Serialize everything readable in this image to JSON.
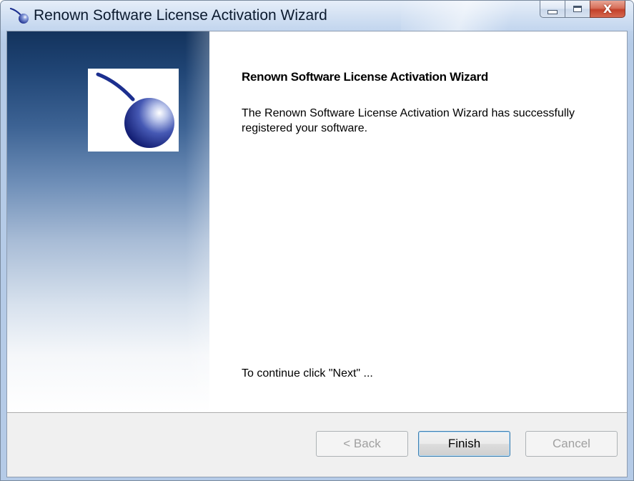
{
  "window": {
    "title": "Renown Software License Activation Wizard",
    "app_icon": "renown-logo-icon",
    "controls": {
      "minimize_icon": "minimize-icon",
      "maximize_icon": "maximize-icon",
      "close_icon": "close-icon",
      "close_glyph": "X"
    }
  },
  "banner": {
    "logo": "renown-logo"
  },
  "wizard": {
    "heading": "Renown Software License Activation Wizard",
    "message": "The Renown Software License Activation Wizard has successfully registered your software.",
    "continue_hint": "To continue click \"Next\" ..."
  },
  "buttons": {
    "back": {
      "label": "< Back",
      "enabled": false
    },
    "finish": {
      "label": "Finish",
      "enabled": true,
      "default": true
    },
    "cancel": {
      "label": "Cancel",
      "enabled": false
    }
  },
  "colors": {
    "banner_top": "#13335d",
    "logo_blue": "#1c2f8f",
    "close_red": "#c2412a",
    "button_bar": "#f0f0f0"
  }
}
